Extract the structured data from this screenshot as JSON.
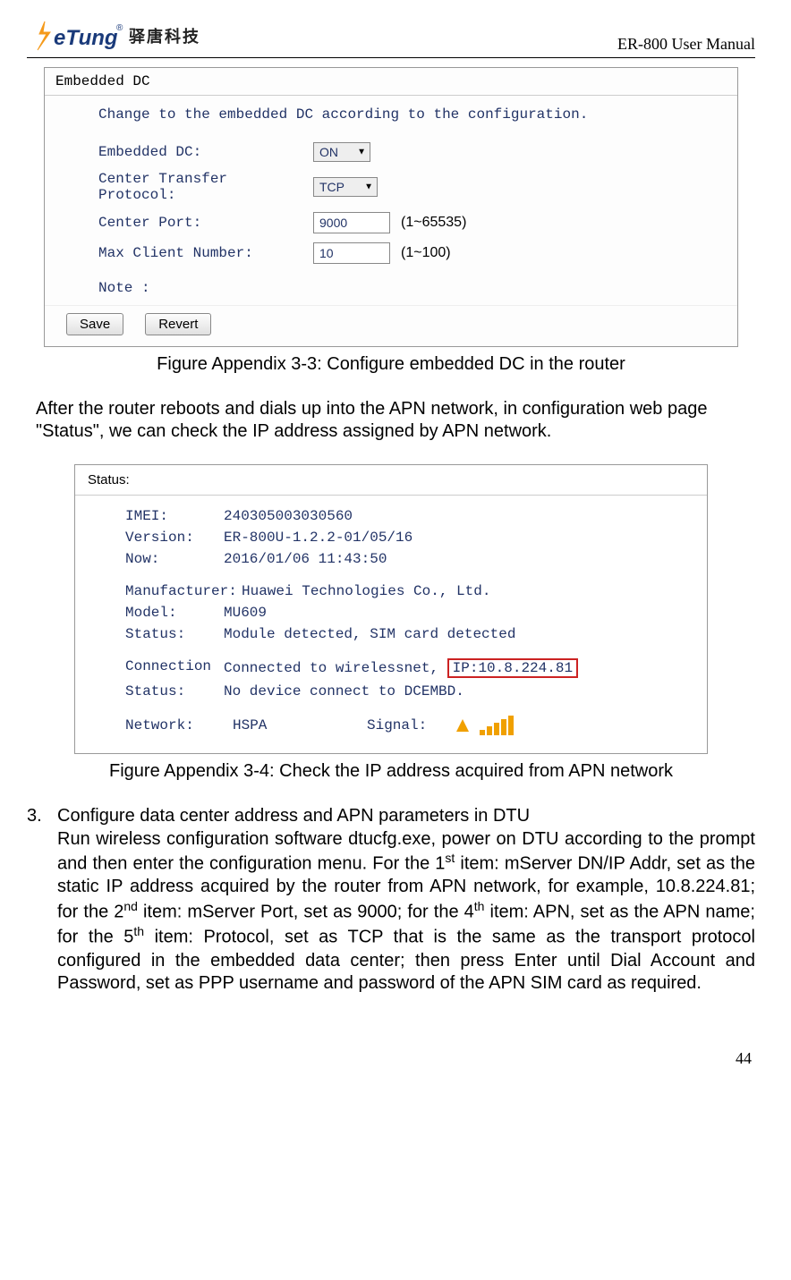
{
  "header": {
    "doc_title": "ER-800 User Manual",
    "logo_text_main": "eTung",
    "logo_text_cn": "驿唐科技"
  },
  "embedded_dc": {
    "panel_title": "Embedded DC",
    "intro": "Change to the embedded DC according to the configuration.",
    "label_embedded_dc": "Embedded DC:",
    "value_embedded_dc": "ON",
    "label_protocol": "Center Transfer Protocol:",
    "value_protocol": "TCP",
    "label_port": "Center Port:",
    "value_port": "9000",
    "hint_port": "(1~65535)",
    "label_max_client": "Max Client Number:",
    "value_max_client": "10",
    "hint_max_client": "(1~100)",
    "label_note": "Note :",
    "btn_save": "Save",
    "btn_revert": "Revert"
  },
  "caption1": "Figure Appendix 3-3: Configure embedded DC in the router",
  "para1": "After the router reboots and dials up into the APN network, in configuration web page \"Status\", we can check the IP address assigned by APN network.",
  "status": {
    "panel_title": "Status:",
    "imei_label": "IMEI:",
    "imei_value": "240305003030560",
    "version_label": "Version:",
    "version_value": "ER-800U-1.2.2-01/05/16",
    "now_label": "Now:",
    "now_value": "2016/01/06 11:43:50",
    "manufacturer_label": "Manufacturer:",
    "manufacturer_value": "Huawei Technologies Co., Ltd.",
    "model_label": "Model:",
    "model_value": "MU609",
    "status_label": "Status:",
    "status_value": "Module detected, SIM card detected",
    "conn_label1": "Connection",
    "conn_label2": "Status:",
    "conn_value1_pre": "Connected to wirelessnet, ",
    "conn_value1_ip": "IP:10.8.224.81",
    "conn_value2": "No device connect to DCEMBD.",
    "network_label": "Network:",
    "network_value": "HSPA",
    "signal_label": "Signal:"
  },
  "caption2": "Figure Appendix 3-4: Check the IP address acquired from APN network",
  "step": {
    "num": "3.",
    "title": "Configure data center address and APN parameters in DTU",
    "body_a": "Run wireless configuration software dtucfg.exe, power on DTU according to the prompt and then enter the configuration menu. For the 1",
    "sup1": "st",
    "body_b": " item: mServer DN/IP Addr, set as the static IP address acquired by the router from APN network, for example, 10.8.224.81; for the 2",
    "sup2": "nd",
    "body_c": " item: mServer Port, set as 9000; for the 4",
    "sup3": "th",
    "body_d": " item: APN, set as the APN name; for the 5",
    "sup4": "th",
    "body_e": " item: Protocol, set as TCP that is the same as the transport protocol configured in the embedded data center; then press Enter until Dial Account and Password, set as PPP username and password of the APN SIM card as required."
  },
  "page_number": "44"
}
